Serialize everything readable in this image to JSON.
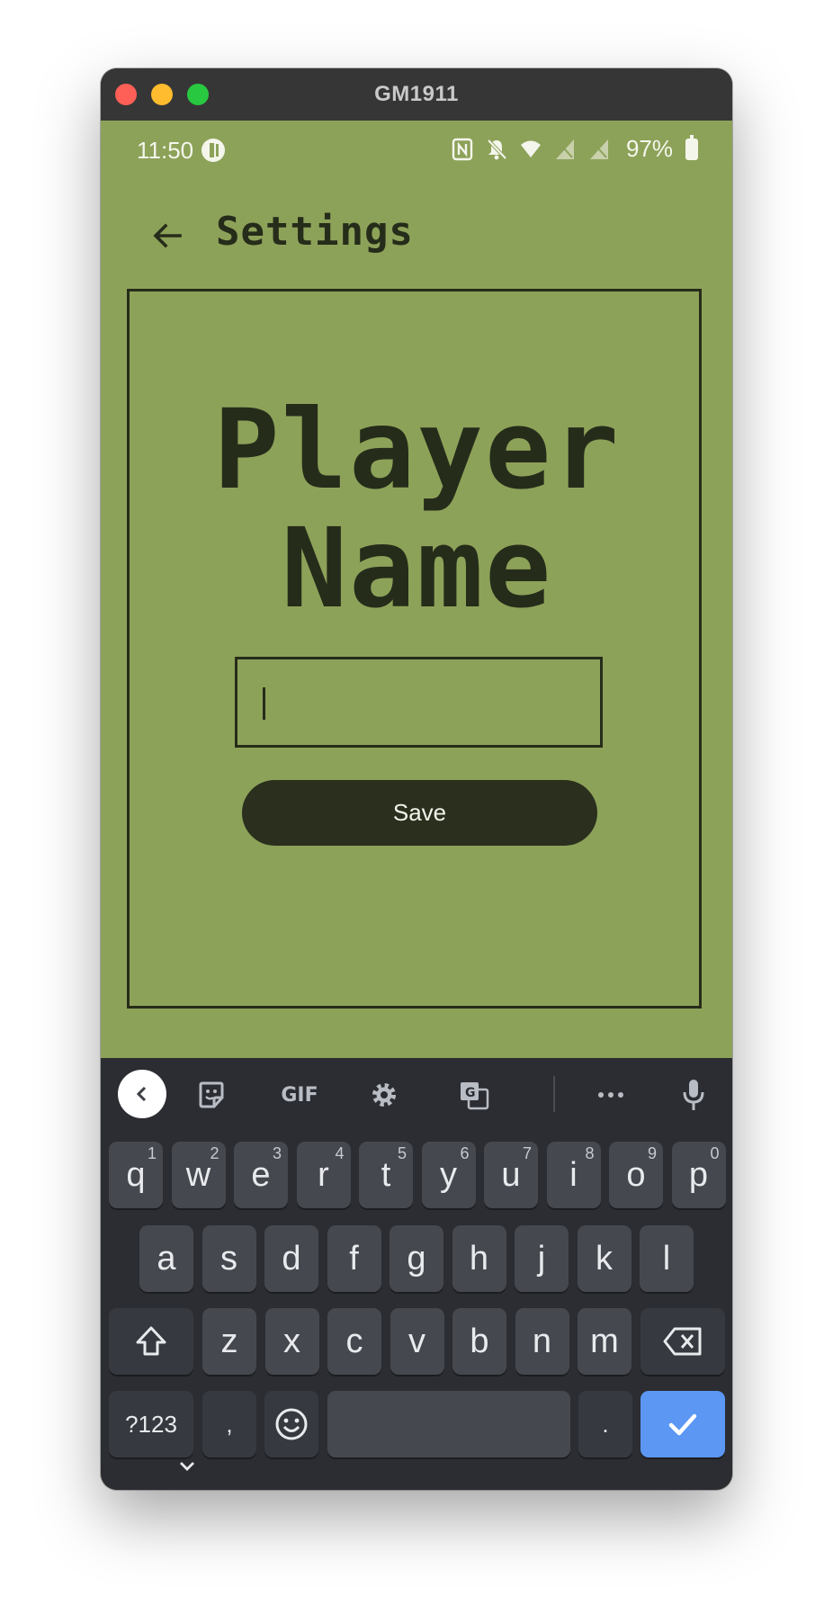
{
  "window": {
    "title": "GM1911"
  },
  "status_bar": {
    "time": "11:50",
    "battery": "97%"
  },
  "app_bar": {
    "title": "Settings"
  },
  "main": {
    "heading_line1": "Player",
    "heading_line2": "Name",
    "name_input_value": "",
    "save_label": "Save"
  },
  "keyboard": {
    "toolbar": [
      "back",
      "sticker",
      "GIF",
      "settings",
      "translate",
      "more",
      "mic"
    ],
    "gif_label": "GIF",
    "row1": [
      {
        "key": "q",
        "hint": "1"
      },
      {
        "key": "w",
        "hint": "2"
      },
      {
        "key": "e",
        "hint": "3"
      },
      {
        "key": "r",
        "hint": "4"
      },
      {
        "key": "t",
        "hint": "5"
      },
      {
        "key": "y",
        "hint": "6"
      },
      {
        "key": "u",
        "hint": "7"
      },
      {
        "key": "i",
        "hint": "8"
      },
      {
        "key": "o",
        "hint": "9"
      },
      {
        "key": "p",
        "hint": "0"
      }
    ],
    "row2": [
      "a",
      "s",
      "d",
      "f",
      "g",
      "h",
      "j",
      "k",
      "l"
    ],
    "row3": [
      "z",
      "x",
      "c",
      "v",
      "b",
      "n",
      "m"
    ],
    "symbols_label": "?123",
    "comma": ",",
    "period": "."
  },
  "colors": {
    "screen_bg": "#8da259",
    "ink": "#262c1a",
    "keyboard_bg": "#2b2d32",
    "key_bg": "#45484e",
    "enter_key": "#5b97f3"
  }
}
